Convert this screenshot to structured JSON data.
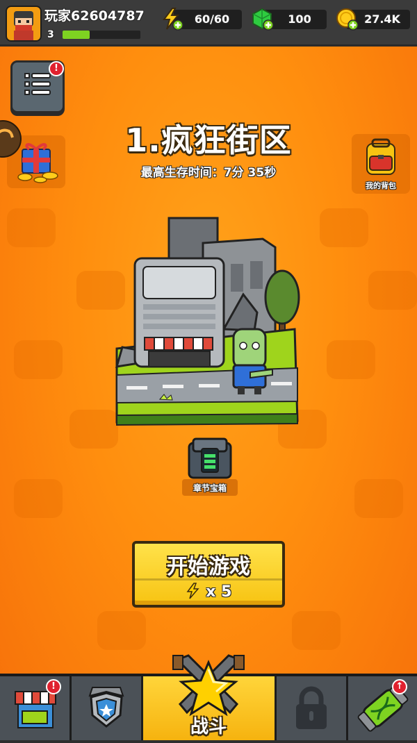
{
  "player": {
    "name": "玩家62604787",
    "level": "3",
    "xp_fraction": 0.35
  },
  "resources": {
    "energy": "60/60",
    "gems": "100",
    "coins": "27.4K"
  },
  "menu": {
    "badge": "!"
  },
  "backpack": {
    "label": "我的背包"
  },
  "stage": {
    "title": "1.疯狂街区",
    "best_time": "最高生存时间：7分 35秒"
  },
  "chapter_chest": {
    "label": "章节宝箱"
  },
  "start_button": {
    "label": "开始游戏",
    "cost": "x 5"
  },
  "nav": {
    "shop_badge": "!",
    "battle_label": "战斗",
    "evolve_badge": "↑"
  },
  "colors": {
    "background": "#ff8e0e",
    "button": "#f7c312",
    "xp": "#7ed321",
    "gem": "#2ecc40"
  }
}
